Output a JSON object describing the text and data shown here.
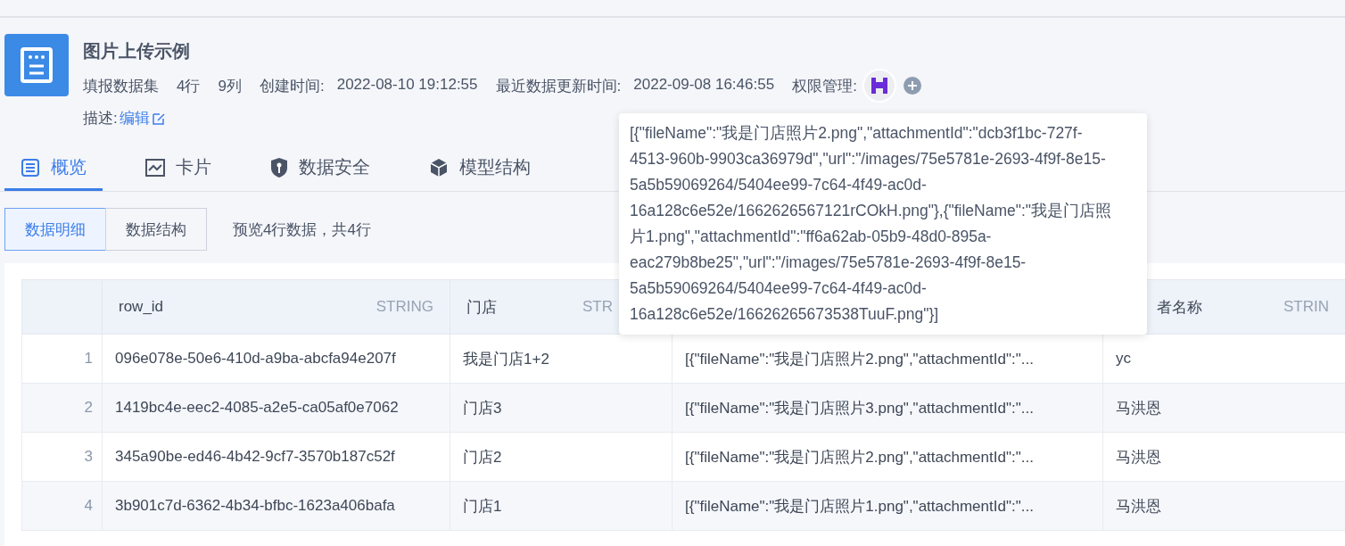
{
  "dataset": {
    "title": "图片上传示例",
    "type": "填报数据集",
    "rows_count": "4行",
    "cols_count": "9列",
    "created_label": "创建时间:",
    "created": "2022-08-10 19:12:55",
    "updated_label": "最近数据更新时间:",
    "updated": "2022-09-08 16:46:55",
    "permission_label": "权限管理:",
    "description_label": "描述:",
    "edit_link": "编辑"
  },
  "tabs": [
    {
      "label": "概览",
      "selected": true
    },
    {
      "label": "卡片",
      "selected": false
    },
    {
      "label": "数据安全",
      "selected": false
    },
    {
      "label": "模型结构",
      "selected": false
    }
  ],
  "view_toggle": [
    {
      "label": "数据明细",
      "selected": true
    },
    {
      "label": "数据结构",
      "selected": false
    }
  ],
  "preview_note": "预览4行数据，共4行",
  "table": {
    "columns": [
      {
        "label": "row_id",
        "type": "STRING"
      },
      {
        "label": "门店",
        "type": "STR"
      },
      {},
      {
        "label": "者名称",
        "type": "STRIN"
      }
    ],
    "rows": [
      {
        "index": "1",
        "cells": [
          "096e078e-50e6-410d-a9ba-abcfa94e207f",
          "我是门店1+2",
          "[{\"fileName\":\"我是门店照片2.png\",\"attachmentId\":\"...",
          "yc"
        ]
      },
      {
        "index": "2",
        "cells": [
          "1419bc4e-eec2-4085-a2e5-ca05af0e7062",
          "门店3",
          "[{\"fileName\":\"我是门店照片3.png\",\"attachmentId\":\"...",
          "马洪恩"
        ]
      },
      {
        "index": "3",
        "cells": [
          "345a90be-ed46-4b42-9cf7-3570b187c52f",
          "门店2",
          "[{\"fileName\":\"我是门店照片2.png\",\"attachmentId\":\"...",
          "马洪恩"
        ]
      },
      {
        "index": "4",
        "cells": [
          "3b901c7d-6362-4b34-bfbc-1623a406bafa",
          "门店1",
          "[{\"fileName\":\"我是门店照片1.png\",\"attachmentId\":\"...",
          "马洪恩"
        ]
      }
    ]
  },
  "tooltip": "[{\"fileName\":\"我是门店照片2.png\",\"attachmentId\":\"dcb3f1bc-727f-4513-960b-9903ca36979d\",\"url\":\"/images/75e5781e-2693-4f9f-8e15-5a5b59069264/5404ee99-7c64-4f49-ac0d-16a128c6e52e/1662626567121rCOkH.png\"},{\"fileName\":\"我是门店照片1.png\",\"attachmentId\":\"ff6a62ab-05b9-48d0-895a-eac279b8be25\",\"url\":\"/images/75e5781e-2693-4f9f-8e15-5a5b59069264/5404ee99-7c64-4f49-ac0d-16a128c6e52e/16626265673538TuuF.png\"}]"
}
